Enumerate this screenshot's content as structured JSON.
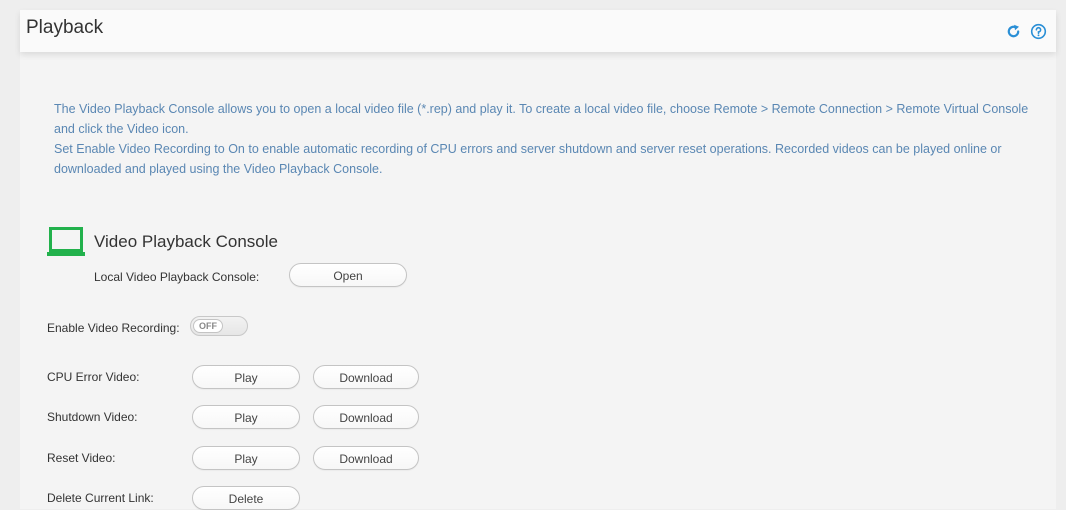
{
  "header": {
    "title": "Playback",
    "refresh_icon": "refresh-icon",
    "help_icon": "help-icon"
  },
  "description": {
    "line1": "The Video Playback Console allows you to open a local video file (*.rep) and play it. To create a local video file, choose Remote > Remote Connection > Remote Virtual Console and click the Video icon.",
    "line2": "Set Enable Video Recording to On to enable automatic recording of CPU errors and server shutdown and server reset operations. Recorded videos can be played online or downloaded and played using the Video Playback Console."
  },
  "console_section": {
    "title": "Video Playback Console",
    "icon": "laptop-icon",
    "local_label": "Local Video Playback Console:",
    "open_label": "Open"
  },
  "recording": {
    "label": "Enable Video Recording:",
    "state": "OFF"
  },
  "videos": [
    {
      "label": "CPU Error Video:",
      "play_label": "Play",
      "download_label": "Download"
    },
    {
      "label": "Shutdown Video:",
      "play_label": "Play",
      "download_label": "Download"
    },
    {
      "label": "Reset Video:",
      "play_label": "Play",
      "download_label": "Download"
    }
  ],
  "delete_link": {
    "label": "Delete Current Link:",
    "button_label": "Delete"
  },
  "colors": {
    "accent": "#2a8fd6",
    "description_text": "#5a87b3",
    "laptop_icon": "#22b14c"
  }
}
